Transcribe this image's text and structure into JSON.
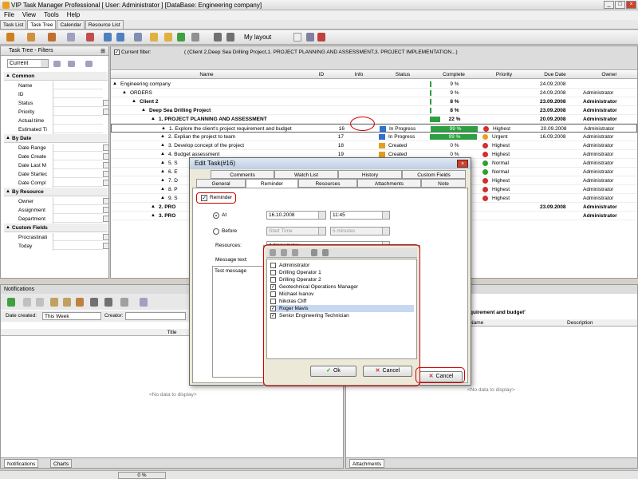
{
  "window": {
    "title": "VIP Task Manager Professional [ User: Administrator ] [DataBase: Engineering company]"
  },
  "menu": [
    "File",
    "View",
    "Tools",
    "Help"
  ],
  "main_tabs": [
    "Task List",
    "Task Tree",
    "Calendar",
    "Resource List"
  ],
  "toolbar": {
    "layout_label": "My layout"
  },
  "filters_panel": {
    "title": "Task Tree - Filters",
    "current": "Current",
    "groups": [
      {
        "name": "Common",
        "items": [
          "Name",
          "ID",
          "Status",
          "Priority",
          "Actual time",
          "Estimated Ti"
        ]
      },
      {
        "name": "By Date",
        "items": [
          "Date Range",
          "Date Create",
          "Date Last M",
          "Date Startec",
          "Date Compl"
        ]
      },
      {
        "name": "By Resource",
        "items": [
          "Owner",
          "Assignment",
          "Department"
        ]
      },
      {
        "name": "Custom Fields",
        "items": [
          "Procrastinati",
          "Today"
        ]
      }
    ]
  },
  "grid": {
    "current_filter_label": "Current filter:",
    "current_filter_text": "( (Client 2,Deep Sea Drilling Project,1. PROJECT PLANNING AND ASSESSMENT,3. PROJECT IMPLEMENTATION...)",
    "columns": [
      "Name",
      "ID",
      "Info",
      "Status",
      "Complete",
      "Priority",
      "Due Date",
      "Owner"
    ],
    "rows": [
      {
        "name": "Engineering company",
        "id": "",
        "status": "",
        "complete": "9 %",
        "priority": "",
        "due": "24.09.2008",
        "owner": "",
        "indent": 12,
        "bold": false,
        "bar": 4
      },
      {
        "name": "ORDERS",
        "id": "",
        "status": "",
        "complete": "9 %",
        "priority": "",
        "due": "24.09.2008",
        "owner": "Administrator",
        "indent": 24,
        "bold": false,
        "bar": 4
      },
      {
        "name": "Client 2",
        "id": "",
        "status": "",
        "complete": "8 %",
        "priority": "",
        "due": "23.09.2008",
        "owner": "Administrator",
        "indent": 36,
        "bold": true,
        "bar": 4
      },
      {
        "name": "Deep Sea Drilling Project",
        "id": "",
        "status": "",
        "complete": "8 %",
        "priority": "",
        "due": "23.09.2008",
        "owner": "Administrator",
        "indent": 48,
        "bold": true,
        "bar": 4
      },
      {
        "name": "1. PROJECT PLANNING AND ASSESSMENT",
        "id": "",
        "status": "",
        "complete": "22 %",
        "priority": "",
        "due": "20.09.2008",
        "owner": "Administrator",
        "indent": 60,
        "bold": true,
        "bar": 22
      },
      {
        "name": "1. Explore the client's project requirement and budget",
        "id": "16",
        "status": "In Progress",
        "complete": "99 %",
        "priority": "Highest",
        "due": "20.09.2008",
        "owner": "Administrator",
        "indent": 72,
        "bold": false,
        "bar": 99,
        "prio_color": "#d03030",
        "selected": true
      },
      {
        "name": "2. Explian the project to team",
        "id": "17",
        "status": "In Progress",
        "complete": "99 %",
        "priority": "Urgent",
        "due": "16.09.2008",
        "owner": "Administrator",
        "indent": 72,
        "bold": false,
        "bar": 99,
        "prio_color": "#e8a020"
      },
      {
        "name": "3. Develop concept of the project",
        "id": "18",
        "status": "Created",
        "complete": "0 %",
        "priority": "Highest",
        "due": "",
        "owner": "Administrator",
        "indent": 72,
        "bold": false,
        "bar": 0,
        "prio_color": "#d03030"
      },
      {
        "name": "4. Budget assessment",
        "id": "19",
        "status": "Created",
        "complete": "0 %",
        "priority": "Highest",
        "due": "",
        "owner": "Administrator",
        "indent": 72,
        "bold": false,
        "bar": 0,
        "prio_color": "#d03030"
      },
      {
        "name": "5. S",
        "id": "",
        "status": "",
        "complete": "",
        "priority": "Normal",
        "due": "",
        "owner": "Administrator",
        "indent": 72,
        "bold": false,
        "bar": 0,
        "prio_color": "#30a030"
      },
      {
        "name": "6. E",
        "id": "",
        "status": "",
        "complete": "",
        "priority": "Normal",
        "due": "",
        "owner": "Administrator",
        "indent": 72,
        "bold": false,
        "bar": 0,
        "prio_color": "#30a030"
      },
      {
        "name": "7. D",
        "id": "",
        "status": "",
        "complete": "",
        "priority": "Highest",
        "due": "",
        "owner": "Administrator",
        "indent": 72,
        "bold": false,
        "bar": 0,
        "prio_color": "#d03030"
      },
      {
        "name": "8. P",
        "id": "",
        "status": "",
        "complete": "",
        "priority": "Highest",
        "due": "",
        "owner": "Administrator",
        "indent": 72,
        "bold": false,
        "bar": 0,
        "prio_color": "#d03030"
      },
      {
        "name": "9. S",
        "id": "",
        "status": "",
        "complete": "",
        "priority": "Highest",
        "due": "",
        "owner": "Administrator",
        "indent": 72,
        "bold": false,
        "bar": 0,
        "prio_color": "#d03030"
      },
      {
        "name": "2. PRO",
        "id": "",
        "status": "",
        "complete": "",
        "priority": "",
        "due": "23.09.2008",
        "owner": "Administrator",
        "indent": 60,
        "bold": true,
        "bar": 0
      },
      {
        "name": "3. PRO",
        "id": "",
        "status": "",
        "complete": "",
        "priority": "",
        "due": "",
        "owner": "Administrator",
        "indent": 60,
        "bold": true,
        "bar": 0
      }
    ]
  },
  "notifications": {
    "title": "Notifications",
    "date_created_label": "Date created:",
    "date_created_value": "This Week",
    "creator_label": "Creator:",
    "col_title": "Title",
    "no_data": "<No data to display>",
    "tabs": [
      "Notifications",
      "Charts"
    ]
  },
  "right_panel": {
    "title": "quirement and budget'",
    "col_name": "Name",
    "col_description": "Description",
    "no_data": "<No data to display>",
    "tab": "Attachments"
  },
  "statusbar": {
    "progress": "0 %"
  },
  "dialog": {
    "title": "Edit Task(#16)",
    "tabs_row1": [
      "Comments",
      "Watch List",
      "History",
      "Custom Fields"
    ],
    "tabs_row2": [
      "General",
      "Reminder",
      "Resources",
      "Attachments",
      "Note"
    ],
    "reminder_label": "Reminder",
    "at_label": "At",
    "at_date": "16.10.2008",
    "at_time": "11:45",
    "before_label": "Before",
    "before_start": "Start Time",
    "before_amount": "5 minutes",
    "resources_label": "Resources:",
    "resources_value": "Administrator",
    "message_label": "Message text:",
    "message_value": "Test message",
    "cancel": "Cancel"
  },
  "resource_popup": {
    "items": [
      {
        "name": "Administrator",
        "checked": false
      },
      {
        "name": "Drilling Operator 1",
        "checked": false
      },
      {
        "name": "Drilling Operator 2",
        "checked": false
      },
      {
        "name": "Geotechnical Operations Manager",
        "checked": true
      },
      {
        "name": "Michael Ivanov",
        "checked": false
      },
      {
        "name": "Nikolas Cliff",
        "checked": false
      },
      {
        "name": "Roger Mavis",
        "checked": true
      },
      {
        "name": "Senior Engineering Technician",
        "checked": true
      }
    ],
    "ok": "Ok",
    "cancel": "Cancel"
  }
}
